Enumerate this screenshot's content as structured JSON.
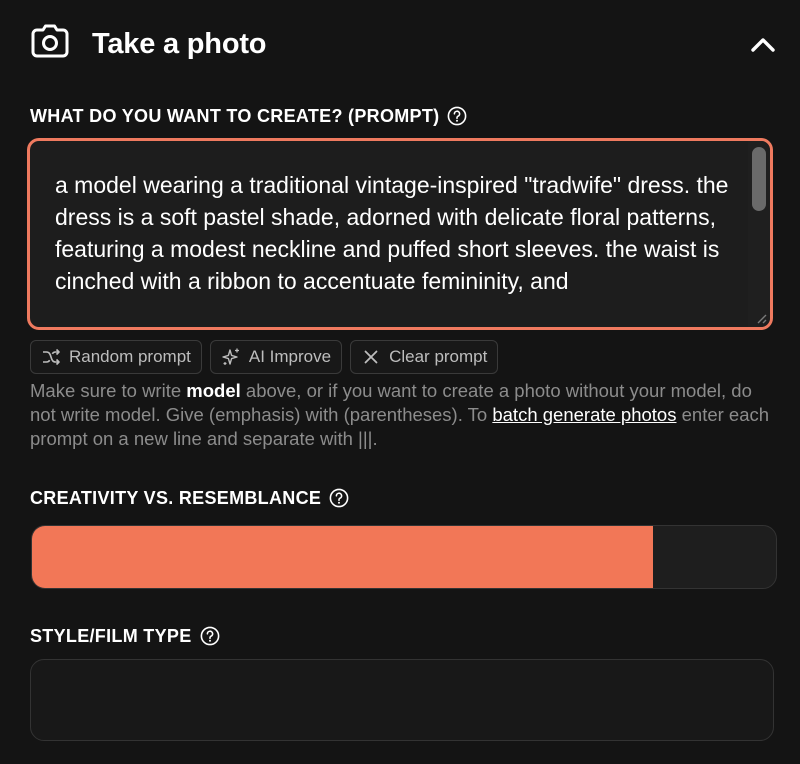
{
  "header": {
    "title": "Take a photo",
    "icon": "camera-icon",
    "collapse_icon": "chevron-up-icon"
  },
  "prompt": {
    "label": "WHAT DO YOU WANT TO CREATE? (PROMPT)",
    "value": "a model wearing a traditional vintage-inspired \"tradwife\" dress. the dress is a soft pastel shade, adorned with delicate floral patterns, featuring a modest neckline and puffed short sleeves. the waist is cinched with a ribbon to accentuate femininity, and",
    "accent_color": "#ef7a5f"
  },
  "actions": {
    "random_label": "Random prompt",
    "improve_label": "AI Improve",
    "clear_label": "Clear prompt"
  },
  "help": {
    "part1": "Make sure to write ",
    "emphasis": "model",
    "part2": " above, or if you want to create a photo without your model, do not write model. Give (emphasis) with (parentheses). To ",
    "link": "batch generate photos",
    "part3": " enter each prompt on a new line and separate with |||."
  },
  "creativity": {
    "label": "CREATIVITY VS. RESEMBLANCE",
    "fill_fraction": 0.835,
    "fill_color": "#f27757"
  },
  "style": {
    "label": "STYLE/FILM TYPE",
    "value": ""
  }
}
